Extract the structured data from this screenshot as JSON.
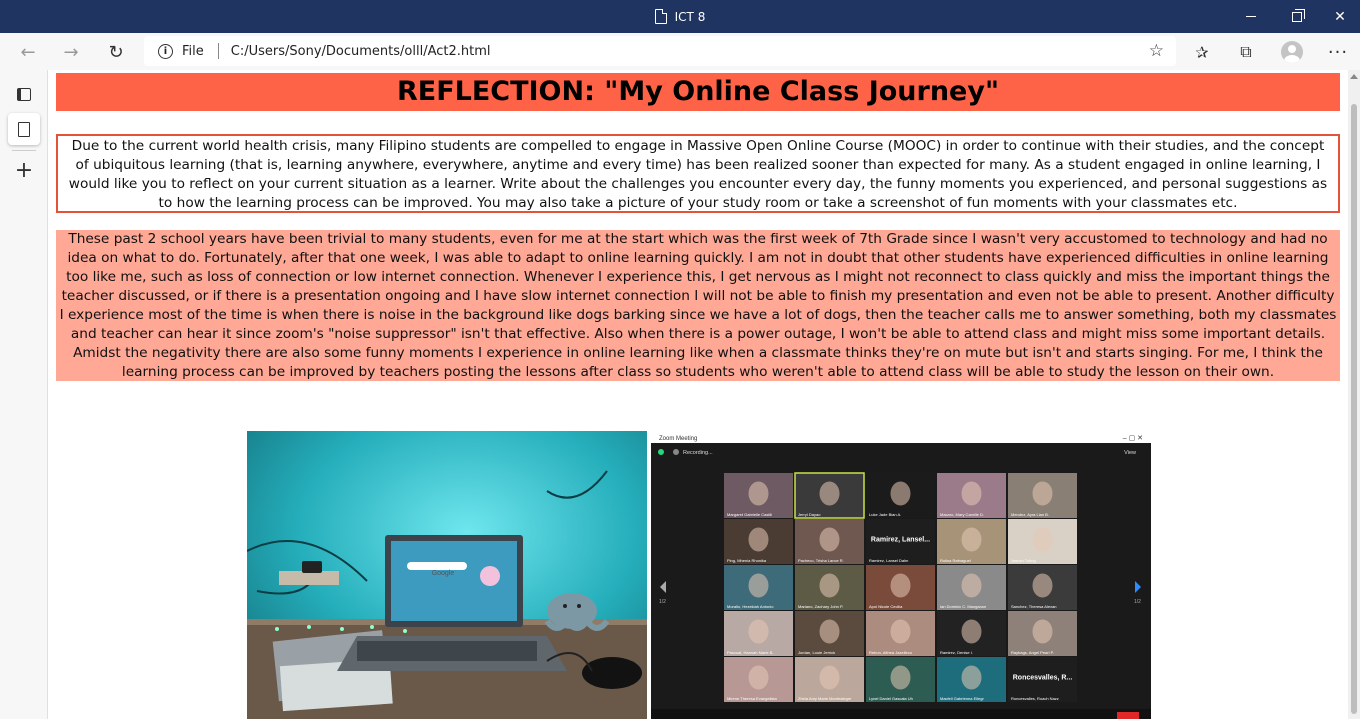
{
  "window": {
    "title": "ICT 8"
  },
  "toolbar": {
    "file_label": "File",
    "url": "C:/Users/Sony/Documents/olll/Act2.html"
  },
  "page": {
    "heading": "REFLECTION: \"My Online Class Journey\"",
    "prompt": "Due to the current world health crisis, many Filipino students are compelled to engage in Massive Open Online Course (MOOC) in order to continue with their studies, and the concept of ubiquitous learning (that is, learning anywhere, everywhere, anytime and every time) has been realized sooner than expected for many. As a student engaged in online learning, I would like you to reflect on your current situation as a learner. Write about the challenges you encounter every day, the funny moments you experienced, and personal suggestions as to how the learning process can be improved. You may also take a picture of your study room or take a screenshot of fun moments with your classmates etc.",
    "response": "These past 2 school years have been trivial to many students, even for me at the start which was the first week of 7th Grade since I wasn't very accustomed to technology and had no idea on what to do. Fortunately, after that one week, I was able to adapt to online learning quickly. I am not in doubt that other students have experienced difficulties in online learning too like me, such as loss of connection or low internet connection. Whenever I experience this, I get nervous as I might not reconnect to class quickly and miss the important things the teacher discussed, or if there is a presentation ongoing and I have slow internet connection I will not be able to finish my presentation and even not be able to present. Another difficulty I experience most of the time is when there is noise in the background like dogs barking since we have a lot of dogs, then the teacher calls me to answer something, both my classmates and teacher can hear it since zoom's \"noise suppressor\" isn't that effective. Also when there is a power outage, I won't be able to attend class and might miss some important details. Amidst the negativity there are also some funny moments I experience in online learning like when a classmate thinks they're on mute but isn't and starts singing. For me, I think the learning process can be improved by teachers posting the lessons after class so students who weren't able to attend class will be able to study the lesson on their own."
  },
  "laptop_screen": {
    "search_label": "Google"
  },
  "zoom": {
    "title": "Zoom Meeting",
    "recording": "Recording...",
    "view": "View",
    "page_left": "1/2",
    "page_right": "1/2",
    "tiles": [
      {
        "name": "Margaret Gabrielle Castill",
        "bg": "#6e5a63"
      },
      {
        "name": "Jerryl Dayao",
        "bg": "#3a3a3a"
      },
      {
        "name": "Luke Jade Bian A.",
        "bg": "#1b1b1b"
      },
      {
        "name": "Macaro, Mary Camille D.",
        "bg": "#9b7a8a"
      },
      {
        "name": "Mendez, Ayra Lian B.",
        "bg": "#8a7f74"
      },
      {
        "name": "Ping, Mhenia Rhonika",
        "bg": "#4a3b33"
      },
      {
        "name": "Pacheco, Trisha Lance R.",
        "bg": "#6e5850"
      },
      {
        "name": "Ramirez, Lansel Dalm",
        "bg": "#1e1e1e",
        "big": "Ramirez, Lansel..."
      },
      {
        "name": "Rolina Rafnaguel",
        "bg": "#a79378"
      },
      {
        "name": "Jasmin Tuting",
        "bg": "#d9d0c6"
      },
      {
        "name": "Morallo, Hezekiah Antonio",
        "bg": "#3d6b7a"
      },
      {
        "name": "Mariano, Zachary John P.",
        "bg": "#5d5b46"
      },
      {
        "name": "Apoi Nicole Cecilia",
        "bg": "#7a4a3a"
      },
      {
        "name": "Ian Dominic C. Manganon",
        "bg": "#8a8a8a"
      },
      {
        "name": "Sanchez, Theresa Alexan",
        "bg": "#3b3b3b"
      },
      {
        "name": "Pascual, Hannah Marie B.",
        "bg": "#b9a9a4"
      },
      {
        "name": "Jordan, Louie Jerrick",
        "bg": "#5a4b3e"
      },
      {
        "name": "Rebon, Althea Jazelleco",
        "bg": "#ad8c80"
      },
      {
        "name": "Ramirez, Denise I.",
        "bg": "#222222"
      },
      {
        "name": "Raybags, Angel Pearl P.",
        "bg": "#8e8179"
      },
      {
        "name": "Mirene Theresa Evangelista",
        "bg": "#b89894"
      },
      {
        "name": "Zhela Amy Marie Montealegre",
        "bg": "#bba79c"
      },
      {
        "name": "Lynel Daniel Gascala Uh",
        "bg": "#2d5d52"
      },
      {
        "name": "Macfell Gabrienna Ellegr",
        "bg": "#1e6d7c"
      },
      {
        "name": "Roncesvalles, Roach Nazz",
        "bg": "#1e1e1e",
        "big": "Roncesvalles, R..."
      }
    ]
  }
}
